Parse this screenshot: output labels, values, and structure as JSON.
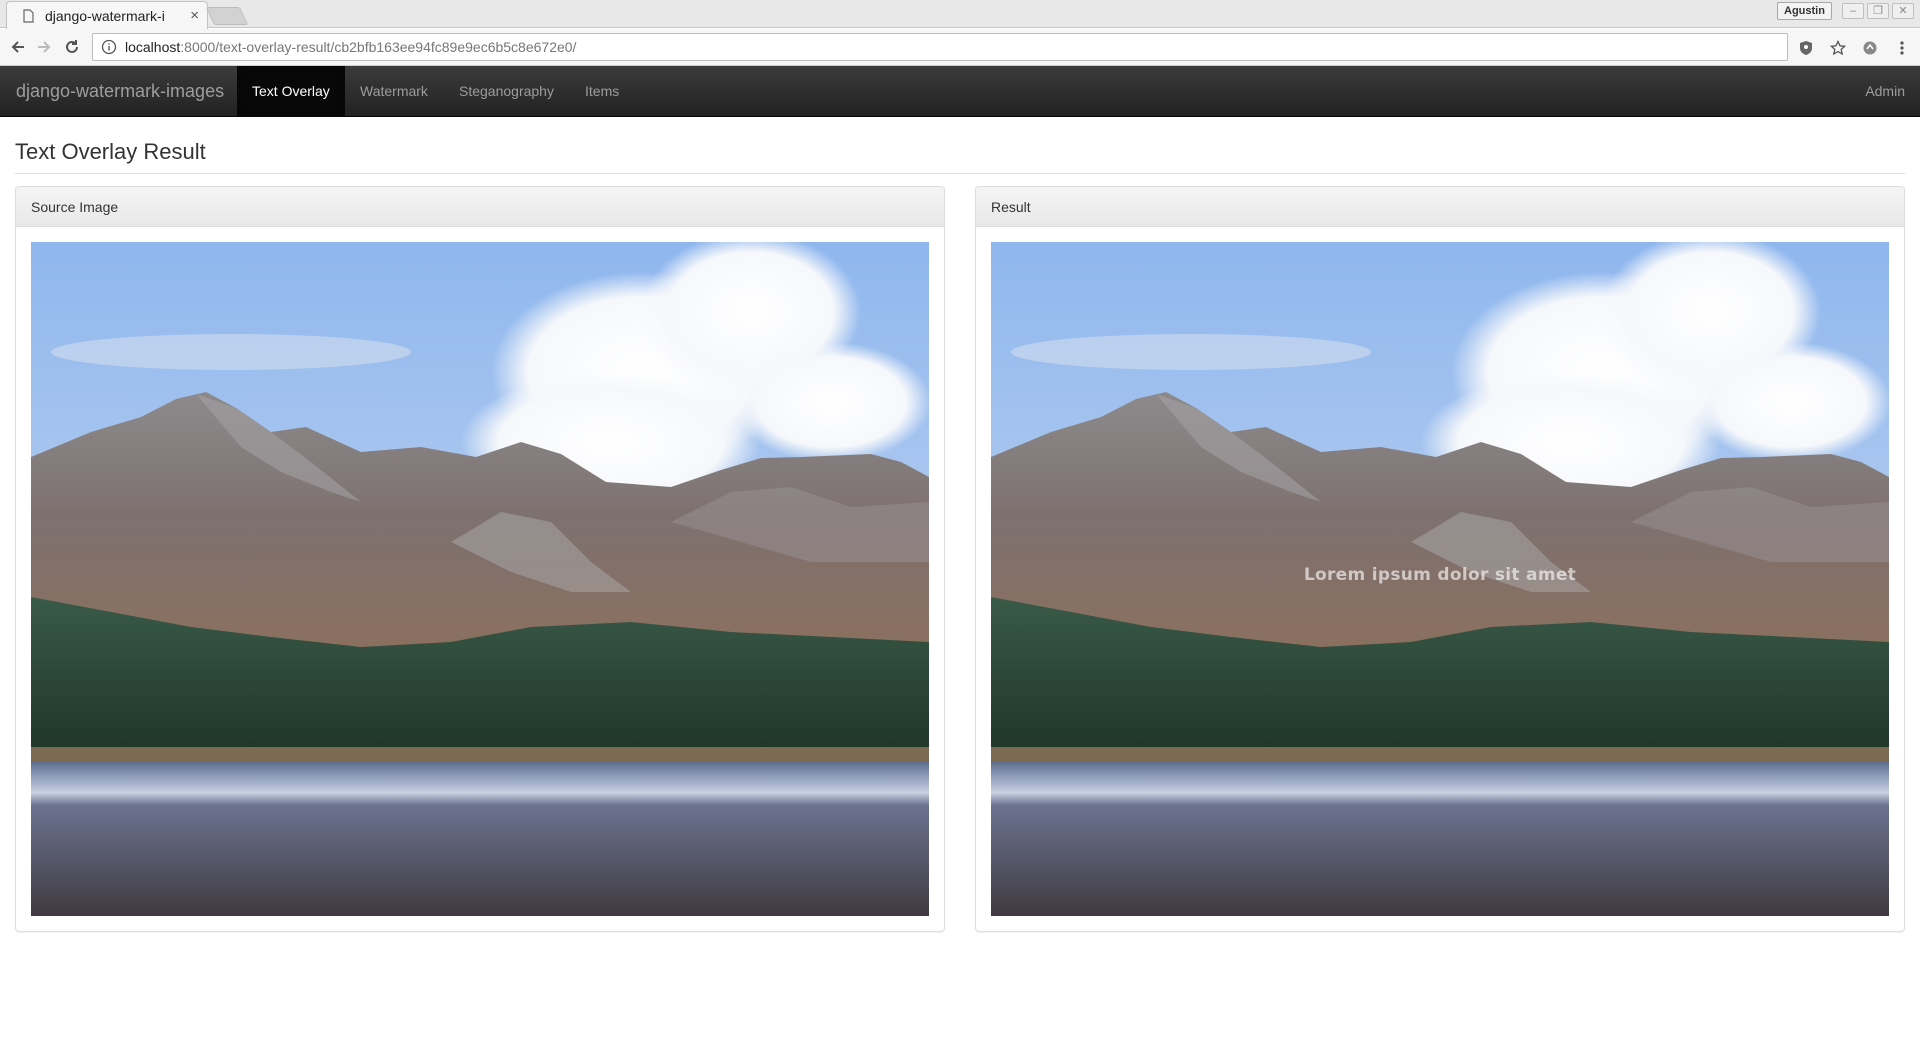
{
  "browser": {
    "tab_title": "django-watermark-i",
    "tab_close": "×",
    "profile_name": "Agustin",
    "url_host": "localhost",
    "url_path": ":8000/text-overlay-result/cb2bfb163ee94fc89e9ec6b5c8e672e0/"
  },
  "navbar": {
    "brand": "django-watermark-images",
    "items": [
      {
        "label": "Text Overlay",
        "active": true
      },
      {
        "label": "Watermark",
        "active": false
      },
      {
        "label": "Steganography",
        "active": false
      },
      {
        "label": "Items",
        "active": false
      }
    ],
    "right_label": "Admin"
  },
  "page": {
    "title": "Text Overlay Result"
  },
  "panels": {
    "source": {
      "heading": "Source Image"
    },
    "result": {
      "heading": "Result",
      "overlay_text": "Lorem ipsum dolor sit amet"
    }
  },
  "colors": {
    "navbar": "#222222",
    "active_nav": "#080808",
    "brand_text": "#9d9d9d"
  }
}
